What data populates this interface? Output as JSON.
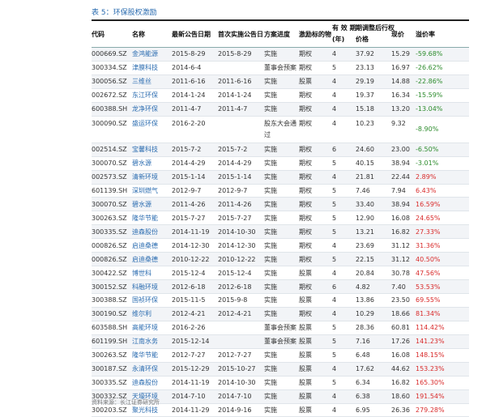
{
  "caption": {
    "label": "表 5：",
    "title": "环保股权激励"
  },
  "headers": {
    "code": "代码",
    "name": "名称",
    "latest_date": "最新公告日期",
    "first_date": "首次实施公告日",
    "progress": "方案进度",
    "type": "激励标的物",
    "validity_line1": "有 效 期",
    "validity_line2": "(年)",
    "price_line1": "期调整后行权",
    "price_line2": "价格",
    "current_price": "现价",
    "premium": "溢价率"
  },
  "rows": [
    {
      "code": "000669.SZ",
      "name": "金鸿能源",
      "latest": "2015-8-29",
      "first": "2015-8-29",
      "progress": "实施",
      "type": "期权",
      "years": "4",
      "strike": "37.92",
      "price": "15.29",
      "premium": "-59.68%",
      "sign": "neg"
    },
    {
      "code": "300334.SZ",
      "name": "津膜科技",
      "latest": "2014-6-4",
      "first": "",
      "progress": "董事会预案",
      "type": "期权",
      "years": "5",
      "strike": "23.13",
      "price": "16.97",
      "premium": "-26.62%",
      "sign": "neg"
    },
    {
      "code": "300056.SZ",
      "name": "三维丝",
      "latest": "2011-6-16",
      "first": "2011-6-16",
      "progress": "实施",
      "type": "股票",
      "years": "4",
      "strike": "29.19",
      "price": "14.88",
      "premium": "-22.86%",
      "sign": "neg"
    },
    {
      "code": "002672.SZ",
      "name": "东江环保",
      "latest": "2014-1-24",
      "first": "2014-1-24",
      "progress": "实施",
      "type": "期权",
      "years": "4",
      "strike": "19.37",
      "price": "16.34",
      "premium": "-15.59%",
      "sign": "neg"
    },
    {
      "code": "600388.SH",
      "name": "龙净环保",
      "latest": "2011-4-7",
      "first": "2011-4-7",
      "progress": "实施",
      "type": "期权",
      "years": "4",
      "strike": "15.18",
      "price": "13.20",
      "premium": "-13.04%",
      "sign": "neg"
    },
    {
      "code": "300090.SZ",
      "name": "盛运环保",
      "latest": "2016-2-20",
      "first": "",
      "progress": "股东大会通过",
      "type": "期权",
      "years": "4",
      "strike": "10.23",
      "price": "9.32",
      "premium": "-8.90%",
      "sign": "neg",
      "tall": true
    },
    {
      "code": "002514.SZ",
      "name": "宝馨科技",
      "latest": "2015-7-2",
      "first": "2015-7-2",
      "progress": "实施",
      "type": "期权",
      "years": "6",
      "strike": "24.60",
      "price": "23.00",
      "premium": "-6.50%",
      "sign": "neg"
    },
    {
      "code": "300070.SZ",
      "name": "碧水源",
      "latest": "2014-4-29",
      "first": "2014-4-29",
      "progress": "实施",
      "type": "期权",
      "years": "5",
      "strike": "40.15",
      "price": "38.94",
      "premium": "-3.01%",
      "sign": "neg"
    },
    {
      "code": "002573.SZ",
      "name": "清新环境",
      "latest": "2015-1-14",
      "first": "2015-1-14",
      "progress": "实施",
      "type": "期权",
      "years": "4",
      "strike": "21.81",
      "price": "22.44",
      "premium": "2.89%",
      "sign": "pos"
    },
    {
      "code": "601139.SH",
      "name": "深圳燃气",
      "latest": "2012-9-7",
      "first": "2012-9-7",
      "progress": "实施",
      "type": "期权",
      "years": "5",
      "strike": "7.46",
      "price": "7.94",
      "premium": "6.43%",
      "sign": "pos"
    },
    {
      "code": "300070.SZ",
      "name": "碧水源",
      "latest": "2011-4-26",
      "first": "2011-4-26",
      "progress": "实施",
      "type": "期权",
      "years": "5",
      "strike": "33.40",
      "price": "38.94",
      "premium": "16.59%",
      "sign": "pos"
    },
    {
      "code": "300263.SZ",
      "name": "隆华节能",
      "latest": "2015-7-27",
      "first": "2015-7-27",
      "progress": "实施",
      "type": "期权",
      "years": "5",
      "strike": "12.90",
      "price": "16.08",
      "premium": "24.65%",
      "sign": "pos"
    },
    {
      "code": "300335.SZ",
      "name": "迪森股份",
      "latest": "2014-11-19",
      "first": "2014-10-30",
      "progress": "实施",
      "type": "期权",
      "years": "5",
      "strike": "13.21",
      "price": "16.82",
      "premium": "27.33%",
      "sign": "pos"
    },
    {
      "code": "000826.SZ",
      "name": "启迪桑德",
      "latest": "2014-12-30",
      "first": "2014-12-30",
      "progress": "实施",
      "type": "期权",
      "years": "4",
      "strike": "23.69",
      "price": "31.12",
      "premium": "31.36%",
      "sign": "pos"
    },
    {
      "code": "000826.SZ",
      "name": "启迪桑德",
      "latest": "2010-12-22",
      "first": "2010-12-22",
      "progress": "实施",
      "type": "期权",
      "years": "5",
      "strike": "22.15",
      "price": "31.12",
      "premium": "40.50%",
      "sign": "pos"
    },
    {
      "code": "300422.SZ",
      "name": "博世科",
      "latest": "2015-12-4",
      "first": "2015-12-4",
      "progress": "实施",
      "type": "股票",
      "years": "4",
      "strike": "20.84",
      "price": "30.78",
      "premium": "47.56%",
      "sign": "pos"
    },
    {
      "code": "300152.SZ",
      "name": "科融环境",
      "latest": "2012-6-18",
      "first": "2012-6-18",
      "progress": "实施",
      "type": "期权",
      "years": "6",
      "strike": "4.82",
      "price": "7.40",
      "premium": "53.53%",
      "sign": "pos"
    },
    {
      "code": "300388.SZ",
      "name": "国祯环保",
      "latest": "2015-11-5",
      "first": "2015-9-8",
      "progress": "实施",
      "type": "股票",
      "years": "4",
      "strike": "13.86",
      "price": "23.50",
      "premium": "69.55%",
      "sign": "pos"
    },
    {
      "code": "300190.SZ",
      "name": "维尔利",
      "latest": "2012-4-21",
      "first": "2012-4-21",
      "progress": "实施",
      "type": "期权",
      "years": "4",
      "strike": "10.29",
      "price": "18.66",
      "premium": "81.34%",
      "sign": "pos"
    },
    {
      "code": "603588.SH",
      "name": "高能环境",
      "latest": "2016-2-26",
      "first": "",
      "progress": "董事会预案",
      "type": "股票",
      "years": "5",
      "strike": "28.36",
      "price": "60.81",
      "premium": "114.42%",
      "sign": "pos"
    },
    {
      "code": "601199.SH",
      "name": "江南水务",
      "latest": "2015-12-14",
      "first": "",
      "progress": "董事会预案",
      "type": "股票",
      "years": "5",
      "strike": "7.16",
      "price": "17.26",
      "premium": "141.23%",
      "sign": "pos"
    },
    {
      "code": "300263.SZ",
      "name": "隆华节能",
      "latest": "2012-7-27",
      "first": "2012-7-27",
      "progress": "实施",
      "type": "股票",
      "years": "5",
      "strike": "6.48",
      "price": "16.08",
      "premium": "148.15%",
      "sign": "pos"
    },
    {
      "code": "300187.SZ",
      "name": "永清环保",
      "latest": "2015-12-29",
      "first": "2015-10-27",
      "progress": "实施",
      "type": "股票",
      "years": "4",
      "strike": "17.62",
      "price": "44.62",
      "premium": "153.23%",
      "sign": "pos"
    },
    {
      "code": "300335.SZ",
      "name": "迪森股份",
      "latest": "2014-11-19",
      "first": "2014-10-30",
      "progress": "实施",
      "type": "股票",
      "years": "5",
      "strike": "6.34",
      "price": "16.82",
      "premium": "165.30%",
      "sign": "pos"
    },
    {
      "code": "300332.SZ",
      "name": "天壕环境",
      "latest": "2014-7-10",
      "first": "2014-7-10",
      "progress": "实施",
      "type": "股票",
      "years": "4",
      "strike": "6.38",
      "price": "18.60",
      "premium": "191.54%",
      "sign": "pos"
    },
    {
      "code": "300203.SZ",
      "name": "聚光科技",
      "latest": "2014-11-29",
      "first": "2014-9-16",
      "progress": "实施",
      "type": "股票",
      "years": "4",
      "strike": "6.95",
      "price": "26.36",
      "premium": "279.28%",
      "sign": "pos"
    }
  ],
  "footnote": "资料来源：长江证券研究所",
  "colors": {
    "negative": "#2d8c2d",
    "positive": "#d92b2b",
    "name_link": "#2b6cb0"
  }
}
